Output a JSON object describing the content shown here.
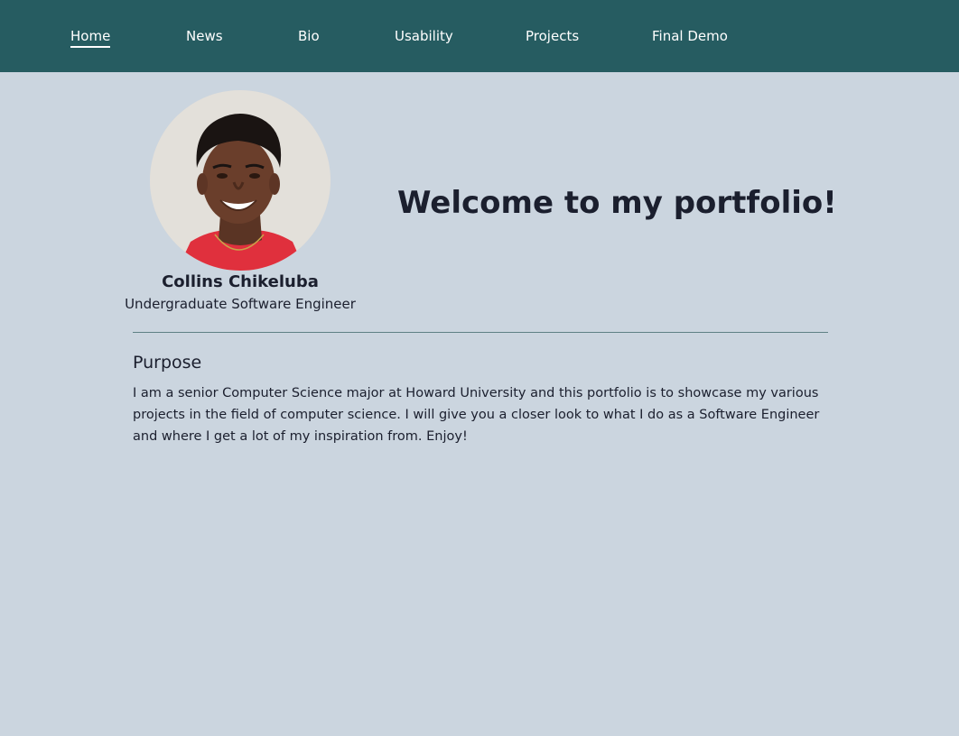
{
  "nav": {
    "items": [
      {
        "label": "Home",
        "active": true
      },
      {
        "label": "News"
      },
      {
        "label": "Bio"
      },
      {
        "label": "Usability"
      },
      {
        "label": "Projects"
      },
      {
        "label": "Final Demo"
      }
    ]
  },
  "profile": {
    "name": "Collins Chikeluba",
    "role": "Undergraduate Software Engineer",
    "avatar_icon": "profile-photo"
  },
  "hero": {
    "title": "Welcome to my portfolio!"
  },
  "purpose": {
    "heading": "Purpose",
    "text": "I am a senior Computer Science major at Howard University and this portfolio is to showcase my various projects in the field of computer science. I will give you a closer look to what I do as a Software Engineer and where I get a lot of my inspiration from. Enjoy!"
  },
  "colors": {
    "header_bg": "#265c61",
    "page_bg": "#cbd5df",
    "text": "#1b1f2e",
    "divider": "#5f8185"
  }
}
